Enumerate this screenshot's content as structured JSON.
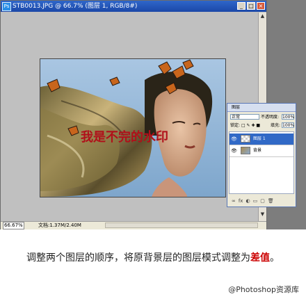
{
  "window": {
    "title": "STB0013.JPG @ 66.7% (图层 1, RGB/8#)",
    "app_icon": "Ps",
    "minimize": "_",
    "maximize": "□",
    "close": "×"
  },
  "canvas": {
    "watermark_text": "我是不完的水印"
  },
  "status": {
    "zoom": "66.67%",
    "doc": "文档:1.37M/2.40M"
  },
  "layers_panel": {
    "tab": "图层",
    "blend_mode": "正常",
    "opacity_label": "不透明度:",
    "opacity_value": "100%",
    "lock_label": "锁定:",
    "lock_icons": "□ ✎ ✚ ■",
    "fill_label": "填充:",
    "fill_value": "100%",
    "layers": [
      {
        "name": "图层 1",
        "selected": true,
        "visible": true
      },
      {
        "name": "背景",
        "selected": false,
        "visible": true
      }
    ],
    "footer_icons": [
      "∞",
      "fx",
      "◐",
      "▭",
      "▢",
      "🗑"
    ]
  },
  "caption": {
    "prefix": "调整两个图层的顺序，将原背景层的图层模式调整为",
    "highlight": "差值",
    "suffix": "。"
  },
  "credit": "@Photoshop资源库",
  "colors": {
    "title_bar": "#1b48a8",
    "watermark": "#b0101a",
    "highlight": "#cc0000"
  }
}
